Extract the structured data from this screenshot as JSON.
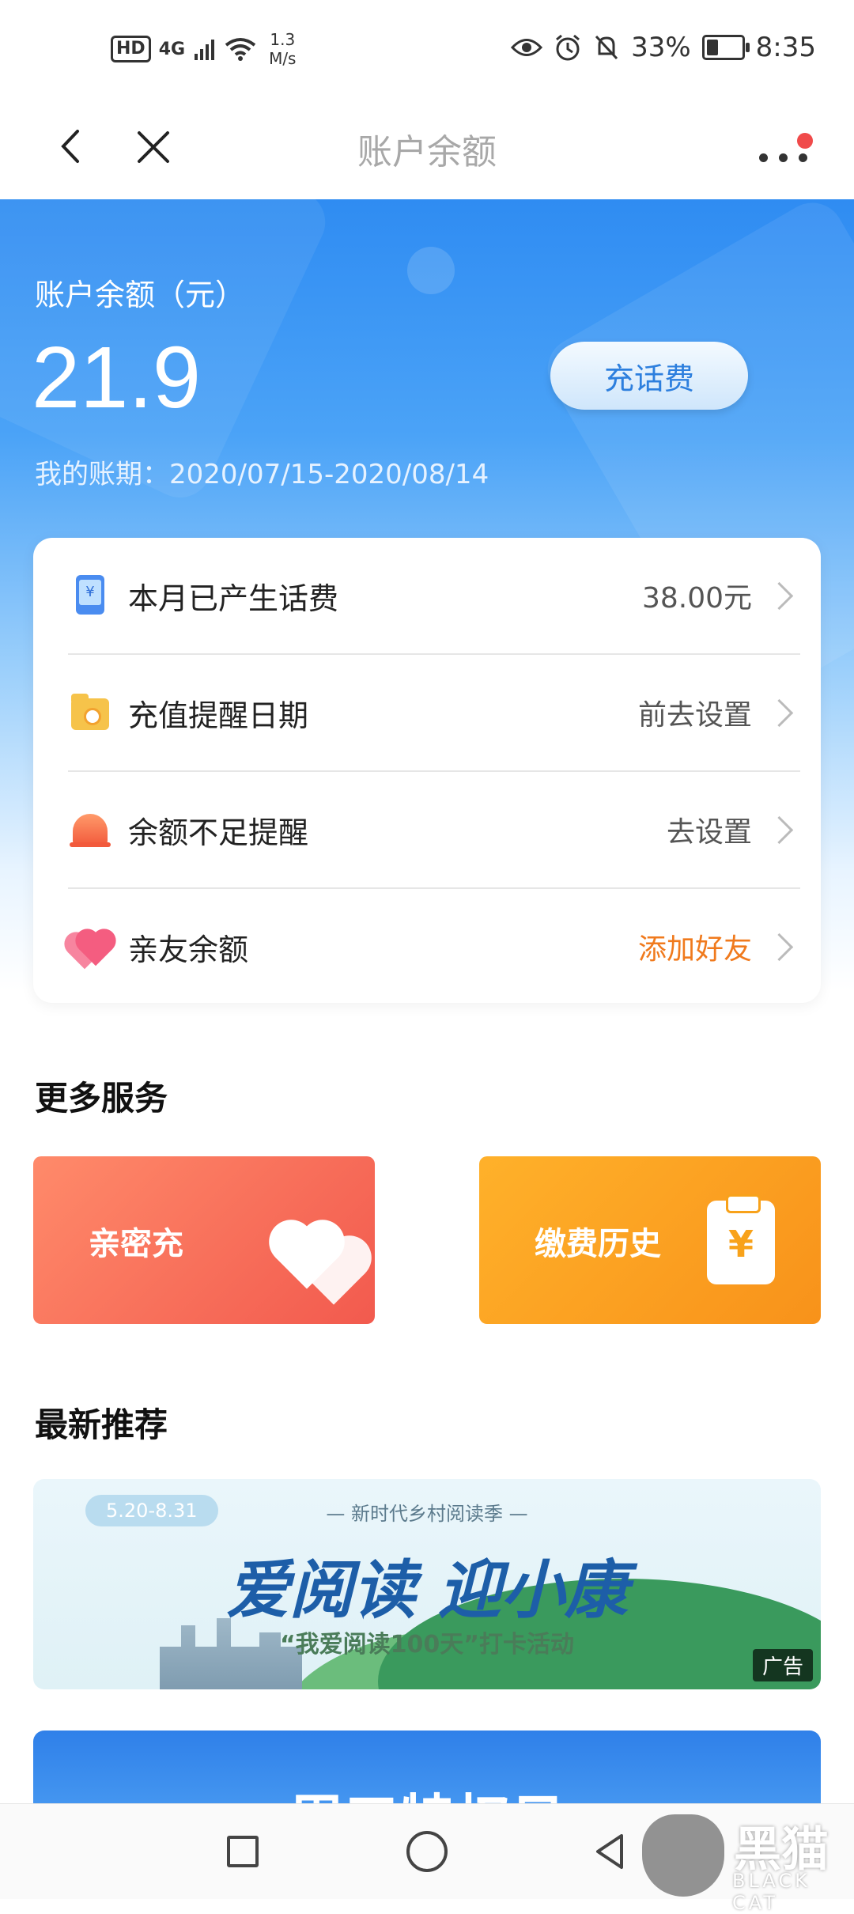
{
  "status_bar": {
    "hd": "HD",
    "network": "4G",
    "speed_value": "1.3",
    "speed_unit": "M/s",
    "battery": "33%",
    "battery_level": 0.33,
    "time": "8:35"
  },
  "nav": {
    "title": "账户余额"
  },
  "balance": {
    "label": "账户余额（元）",
    "value": "21.9",
    "recharge_button": "充话费",
    "period": "我的账期：2020/07/15-2020/08/14"
  },
  "card_rows": [
    {
      "label": "本月已产生话费",
      "value": "38.00元"
    },
    {
      "label": "充值提醒日期",
      "value": "前去设置"
    },
    {
      "label": "余额不足提醒",
      "value": "去设置"
    },
    {
      "label": "亲友余额",
      "value": "添加好友"
    }
  ],
  "more_services": {
    "title": "更多服务",
    "items": [
      {
        "label": "亲密充"
      },
      {
        "label": "缴费历史"
      }
    ]
  },
  "recommend": {
    "title": "最新推荐",
    "banner": {
      "date": "5.20-8.31",
      "subtitle": "— 新时代乡村阅读季 —",
      "main": "爱阅读 迎小康",
      "cta": "“我爱阅读100天”打卡活动",
      "ad_tag": "广告"
    },
    "banner2_text": "周五特权日"
  },
  "watermark": {
    "text": "黑猫",
    "sub": "BLACK CAT"
  },
  "colors": {
    "accent_blue": "#2f8cf2",
    "orange": "#f07a1d"
  }
}
